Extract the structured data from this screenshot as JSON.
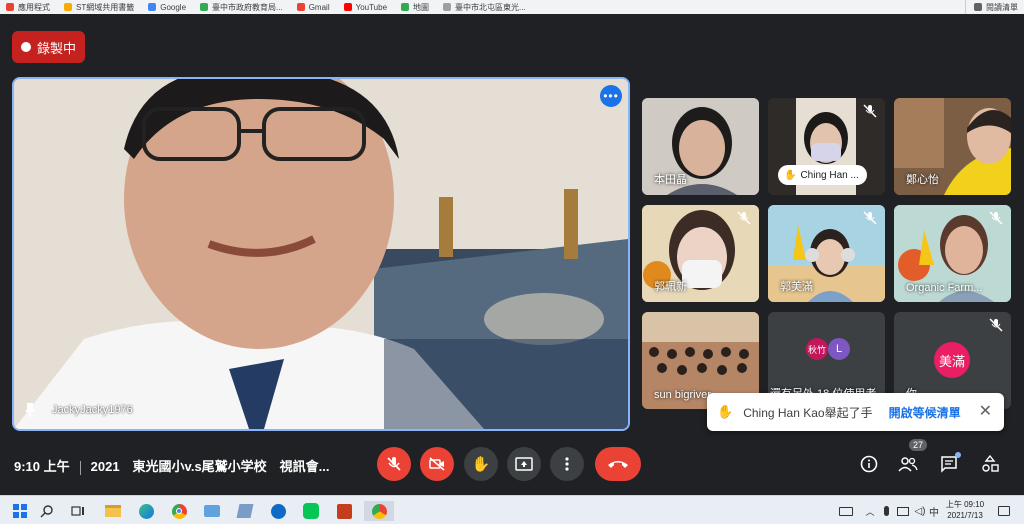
{
  "bookmarks": [
    {
      "label": "應用程式",
      "color": "#ea4335"
    },
    {
      "label": "ST網域共用書籤",
      "color": "#f9ab00"
    },
    {
      "label": "Google",
      "color": "#4285f4"
    },
    {
      "label": "臺中市政府教育局...",
      "color": "#34a853"
    },
    {
      "label": "Gmail",
      "color": "#ea4335"
    },
    {
      "label": "YouTube",
      "color": "#ff0000"
    },
    {
      "label": "地圖",
      "color": "#34a853"
    },
    {
      "label": "臺中市北屯區東光...",
      "color": "#9aa0a6"
    }
  ],
  "reading_list": "閱讀清單",
  "recording": {
    "label": "錄製中"
  },
  "main_speaker": {
    "name": "JackyJacky1976",
    "more_label": "•••"
  },
  "tiles": [
    {
      "name": "本田晶",
      "muted": false,
      "bg": "#c9c6c0"
    },
    {
      "name": "Ching Han ...",
      "muted": true,
      "bg": "#2f2a26",
      "hand": true
    },
    {
      "name": "鄭心怡",
      "muted": false,
      "bg": "#8a6a4c"
    },
    {
      "name": "郭珮新",
      "muted": true,
      "bg": "#d9cfb8"
    },
    {
      "name": "郭美滿",
      "muted": true,
      "bg": "#9bc7d9"
    },
    {
      "name": "Organic Farm...",
      "muted": true,
      "bg": "#b9d3cf"
    },
    {
      "name": "sun bigriver",
      "muted": false,
      "bg": "#a0735a"
    },
    {
      "name": "還有另外 18 位使用者",
      "muted": false,
      "bg": "#3c4043",
      "avatars": [
        {
          "letter": "秋竹",
          "color": "#c2185b"
        },
        {
          "letter": "L",
          "color": "#7e57c2"
        }
      ]
    },
    {
      "name": "你",
      "muted": true,
      "bg": "#3c4043",
      "avatar": {
        "letter": "美滿",
        "color": "#e91e63"
      }
    }
  ],
  "toast": {
    "text": "Ching Han Kao舉起了手",
    "action": "開啟等候清單"
  },
  "bottom_bar": {
    "time": "9:10 上午",
    "meeting_title": "2021　東光國小v.s尾鷲小学校　視訊會...",
    "participants_count": "27"
  },
  "taskbar": {
    "time": "上午 09:10",
    "date": "2021/7/13",
    "ime": "中"
  }
}
